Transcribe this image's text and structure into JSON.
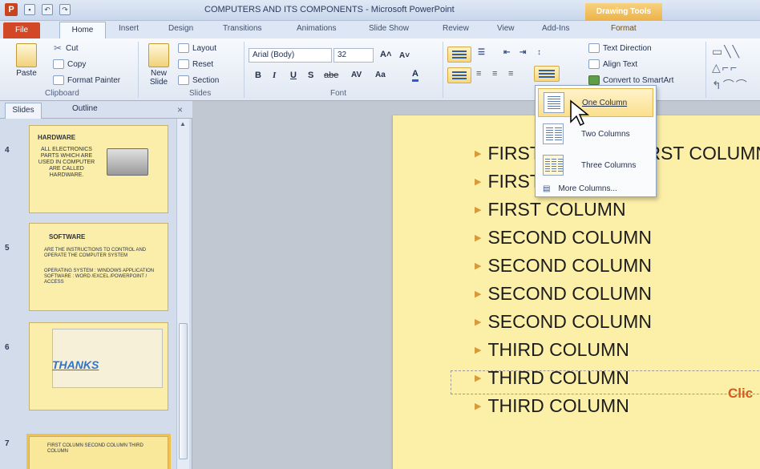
{
  "window": {
    "title": "COMPUTERS AND ITS COMPONENTS  -  Microsoft PowerPoint",
    "context_tab_header": "Drawing Tools",
    "logo_letter": "P"
  },
  "ribbon_tabs": [
    "File",
    "Home",
    "Insert",
    "Design",
    "Transitions",
    "Animations",
    "Slide Show",
    "Review",
    "View",
    "Add-Ins",
    "Format"
  ],
  "clipboard": {
    "paste": "Paste",
    "cut": "Cut",
    "copy": "Copy",
    "format_painter": "Format Painter",
    "group": "Clipboard"
  },
  "slides_group": {
    "new_slide": "New Slide",
    "layout": "Layout",
    "reset": "Reset",
    "section": "Section",
    "group": "Slides"
  },
  "font_group": {
    "font_name": "Arial (Body)",
    "font_size": "32",
    "group": "Font",
    "bold": "B",
    "italic": "I",
    "underline": "U",
    "strike": "abe"
  },
  "paragraph_group": {
    "text_direction": "Text Direction",
    "align_text": "Align Text",
    "convert_smartart": "Convert to SmartArt"
  },
  "left_pane": {
    "tab_slides": "Slides",
    "tab_outline": "Outline",
    "close": "×"
  },
  "thumbnails": [
    {
      "number": "4",
      "title": "HARDWARE",
      "body": "ALL ELECTRONICS PARTS WHICH ARE USED IN COMPUTER ARE CALLED HARDWARE."
    },
    {
      "number": "5",
      "title": "SOFTWARE",
      "body": "ARE THE INSTRUCTIONS TO CONTROL AND OPERATE THE COMPUTER SYSTEM",
      "body2": "OPERATING SYSTEM : WINDOWS APPLICATION SOFTWARE : WORD /EXCEL /POWERPOINT / ACCESS"
    },
    {
      "number": "6",
      "title": "THANKS"
    },
    {
      "number": "7",
      "body": "FIRST COLUMN  SECOND COLUMN  THIRD COLUMN"
    }
  ],
  "slide_bullets": [
    "FIRST COLUMN FIRST COLUMN",
    "FIRST COLUMN",
    "FIRST COLUMN",
    "SECOND COLUMN",
    "SECOND COLUMN",
    "SECOND COLUMN",
    "SECOND COLUMN",
    "THIRD COLUMN",
    "THIRD COLUMN",
    "THIRD COLUMN"
  ],
  "slide_hint": "Clic",
  "columns_menu": {
    "items": [
      "One Column",
      "Two Columns",
      "Three Columns"
    ],
    "more": "More Columns..."
  },
  "icons": [
    "logo-icon",
    "save-icon",
    "undo-icon",
    "redo-icon",
    "paste-icon",
    "scissors-icon",
    "copy-icon",
    "format-painter-icon",
    "new-slide-icon",
    "layout-icon",
    "reset-icon",
    "section-icon",
    "bullets-icon",
    "numbering-icon",
    "columns-icon",
    "mouse-cursor-icon"
  ],
  "colors": {
    "file_tab": "#d24726",
    "context_tab": "#ecb247",
    "slide_bg": "#fcefa8",
    "bullet_arrow": "#d79a3a",
    "hint": "#d45b1f"
  }
}
